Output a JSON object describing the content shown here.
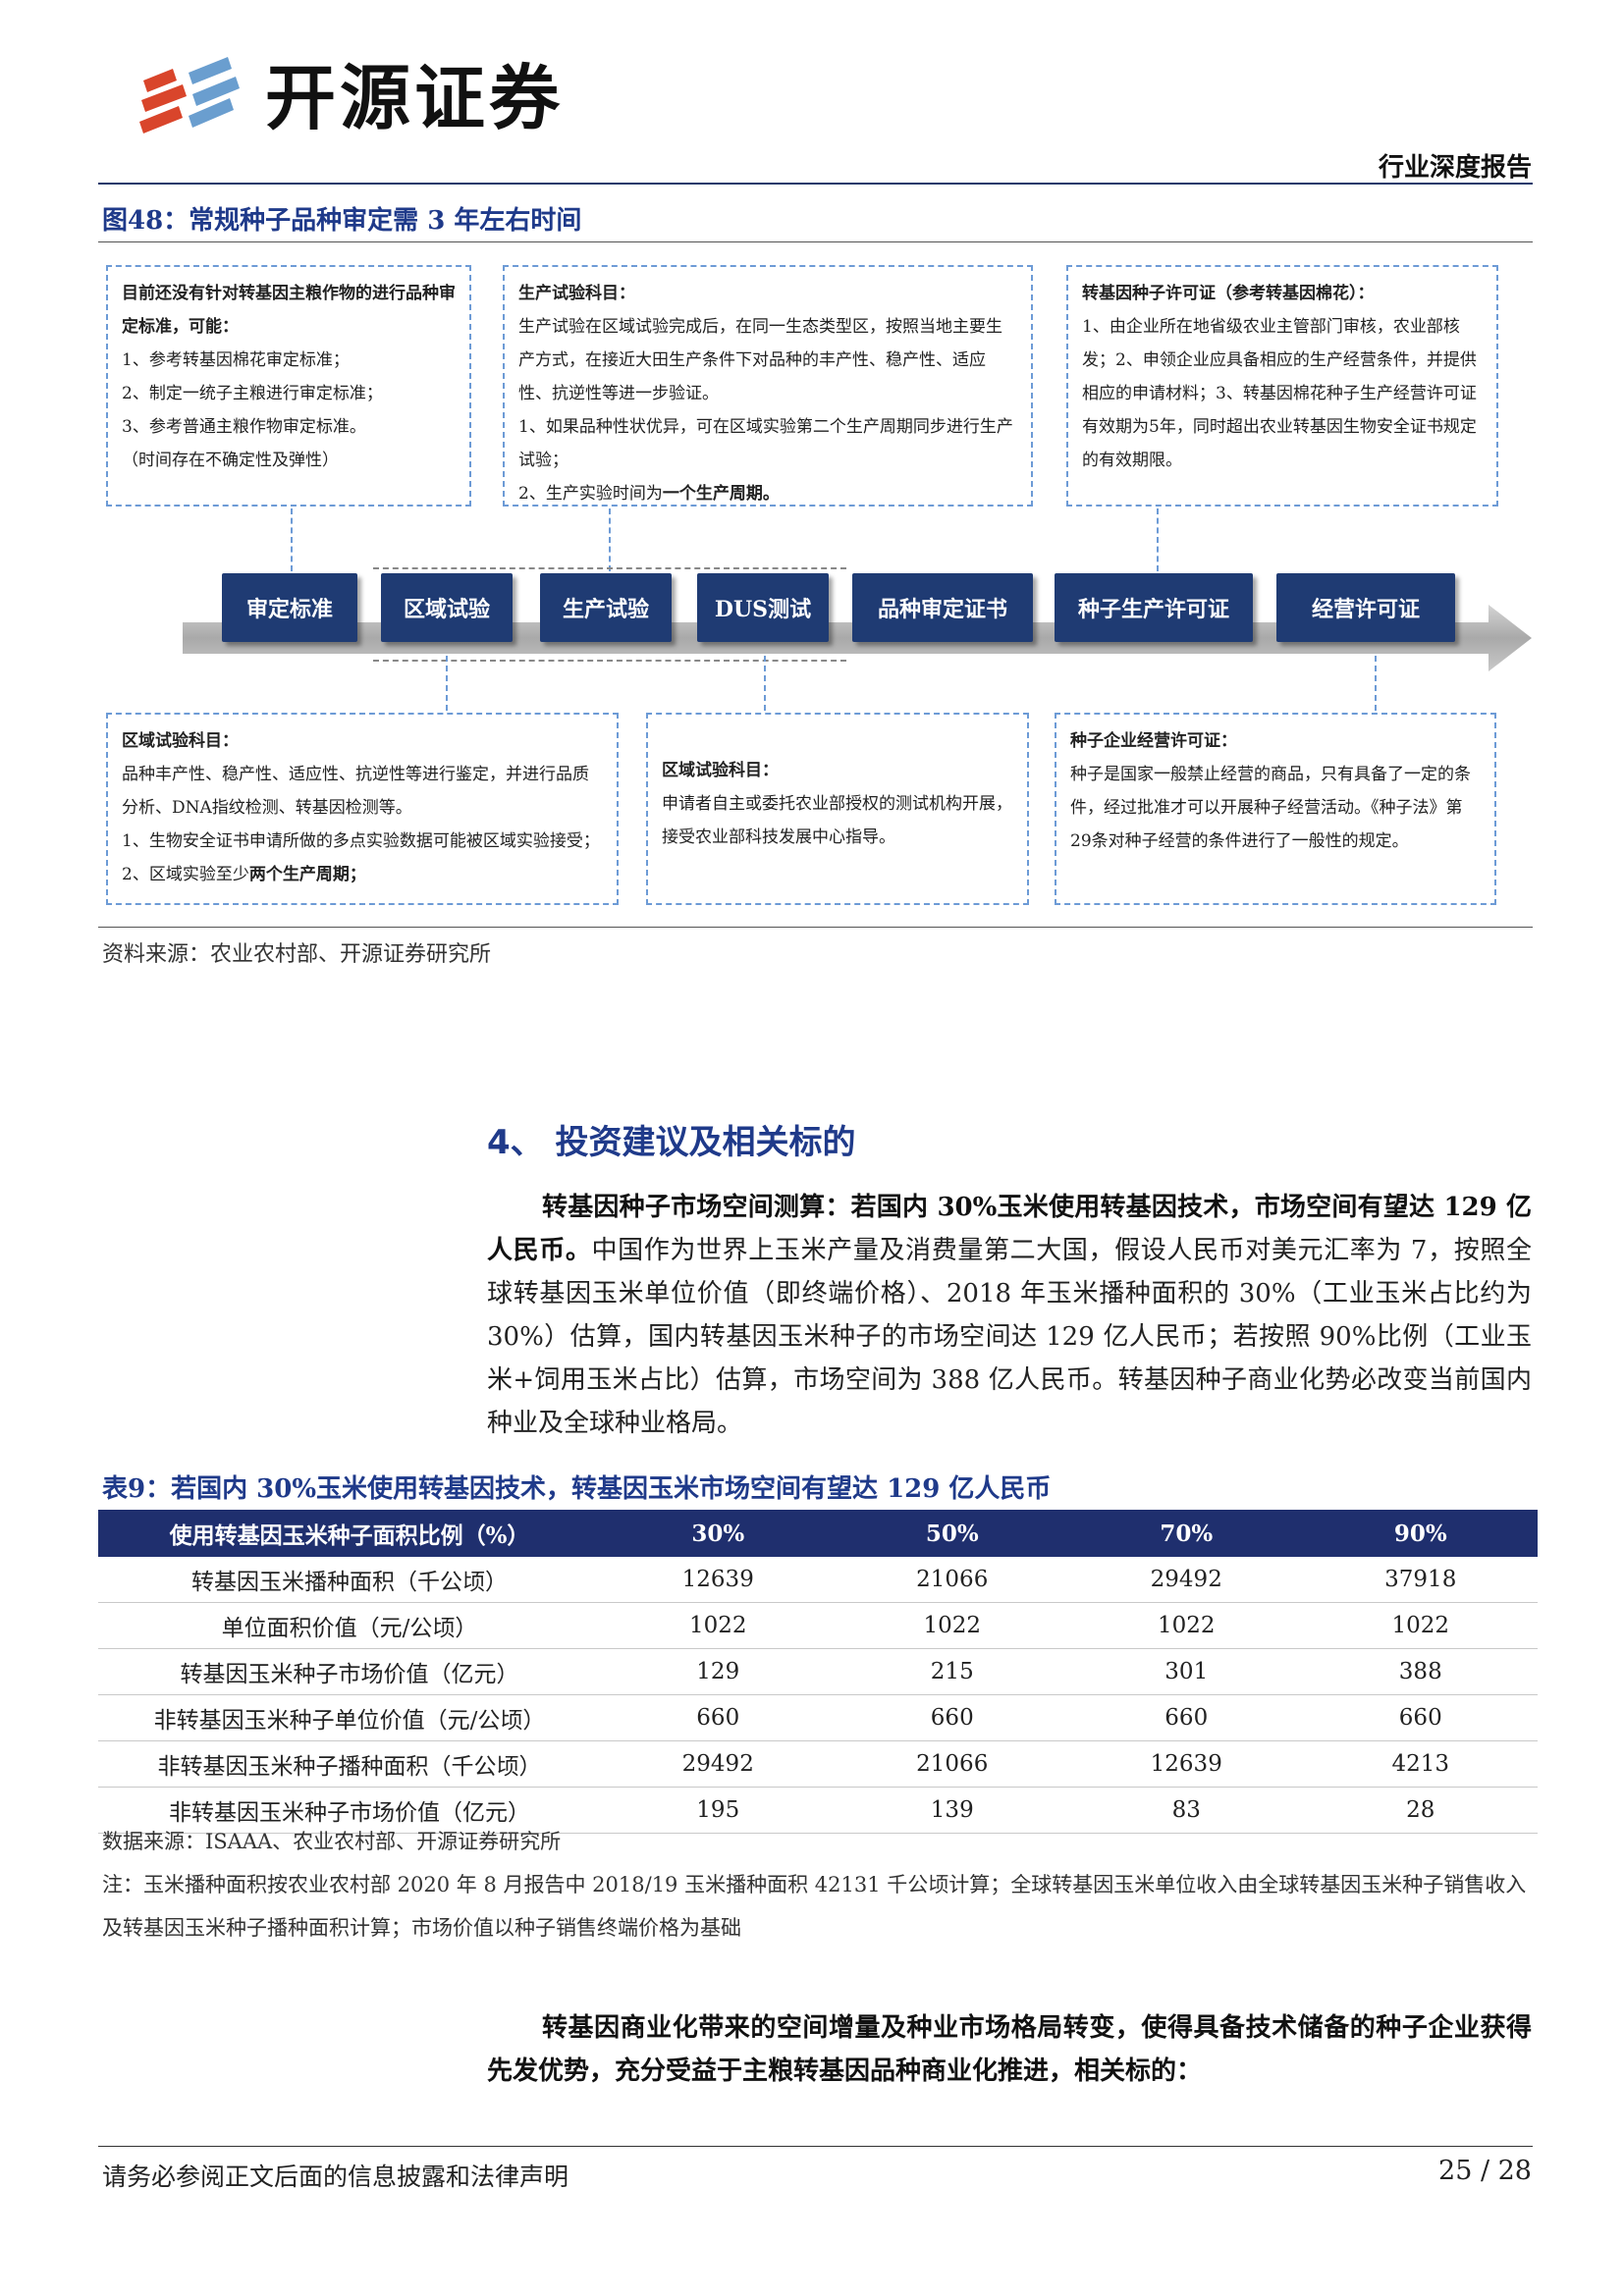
{
  "header": {
    "logo_text": "开源证券",
    "report_type": "行业深度报告"
  },
  "figure": {
    "title": "图48：常规种子品种审定需 3 年左右时间",
    "source": "资料来源：农业农村部、开源证券研究所",
    "stages": [
      "审定标准",
      "区域试验",
      "生产试验",
      "DUS测试",
      "品种审定证书",
      "种子生产许可证",
      "经营许可证"
    ],
    "top_boxes": [
      {
        "title": "目前还没有针对转基因主粮作物的进行品种审定标准，可能：",
        "lines": [
          "1、参考转基因棉花审定标准；",
          "2、制定一统子主粮进行审定标准；",
          "3、参考普通主粮作物审定标准。",
          "（时间存在不确定性及弹性）"
        ]
      },
      {
        "title": "生产试验科目：",
        "lines": [
          "生产试验在区域试验完成后，在同一生态类型区，按照当地主要生产方式，在接近大田生产条件下对品种的丰产性、稳产性、适应性、抗逆性等进一步验证。",
          "1、如果品种性状优异，可在区域实验第二个生产周期同步进行生产试验；",
          "2、生产实验时间为"
        ],
        "bold_tail": "一个生产周期。"
      },
      {
        "title": "转基因种子许可证（参考转基因棉花）：",
        "lines": [
          "1、由企业所在地省级农业主管部门审核，农业部核发；2、申领企业应具备相应的生产经营条件，并提供相应的申请材料；3、转基因棉花种子生产经营许可证有效期为5年，同时超出农业转基因生物安全证书规定的有效期限。"
        ]
      }
    ],
    "bottom_boxes": [
      {
        "title": "区域试验科目：",
        "lines": [
          "品种丰产性、稳产性、适应性、抗逆性等进行鉴定，并进行品质分析、DNA指纹检测、转基因检测等。",
          "1、生物安全证书申请所做的多点实验数据可能被区域实验接受；2、区域实验至少"
        ],
        "bold_tail": "两个生产周期；"
      },
      {
        "title": "区域试验科目：",
        "lines": [
          "申请者自主或委托农业部授权的测试机构开展，接受农业部科技发展中心指导。"
        ]
      },
      {
        "title": "种子企业经营许可证：",
        "lines": [
          "种子是国家一般禁止经营的商品，只有具备了一定的条件，经过批准才可以开展种子经营活动。《种子法》第29条对种子经营的条件进行了一般性的规定。"
        ]
      }
    ]
  },
  "section": {
    "heading": "4、 投资建议及相关标的",
    "para1_bold": "转基因种子市场空间测算：若国内 30%玉米使用转基因技术，市场空间有望达 129 亿人民币。",
    "para1_rest": "中国作为世界上玉米产量及消费量第二大国，假设人民币对美元汇率为 7，按照全球转基因玉米单位价值（即终端价格）、2018 年玉米播种面积的 30%（工业玉米占比约为 30%）估算，国内转基因玉米种子的市场空间达 129 亿人民币；若按照 90%比例（工业玉米+饲用玉米占比）估算，市场空间为 388 亿人民币。转基因种子商业化势必改变当前国内种业及全球种业格局。",
    "para2_bold": "转基因商业化带来的空间增量及种业市场格局转变，使得具备技术储备的种子企业获得先发优势，充分受益于主粮转基因品种商业化推进，相关标的："
  },
  "table": {
    "title": "表9：若国内 30%玉米使用转基因技术，转基因玉米市场空间有望达 129 亿人民币",
    "header": [
      "使用转基因玉米种子面积比例（%）",
      "30%",
      "50%",
      "70%",
      "90%"
    ],
    "rows": [
      [
        "转基因玉米播种面积（千公顷）",
        "12639",
        "21066",
        "29492",
        "37918"
      ],
      [
        "单位面积价值（元/公顷）",
        "1022",
        "1022",
        "1022",
        "1022"
      ],
      [
        "转基因玉米种子市场价值（亿元）",
        "129",
        "215",
        "301",
        "388"
      ],
      [
        "非转基因玉米种子单位价值（元/公顷）",
        "660",
        "660",
        "660",
        "660"
      ],
      [
        "非转基因玉米种子播种面积（千公顷）",
        "29492",
        "21066",
        "12639",
        "4213"
      ],
      [
        "非转基因玉米种子市场价值（亿元）",
        "195",
        "139",
        "83",
        "28"
      ]
    ],
    "source": "数据来源：ISAAA、农业农村部、开源证券研究所",
    "note": "注：玉米播种面积按农业农村部 2020 年 8 月报告中 2018/19 玉米播种面积 42131 千公顷计算；全球转基因玉米单位收入由全球转基因玉米种子销售收入及转基因玉米种子播种面积计算；市场价值以种子销售终端价格为基础"
  },
  "footer": {
    "disclaimer": "请务必参阅正文后面的信息披露和法律声明",
    "page": "25 / 28"
  }
}
